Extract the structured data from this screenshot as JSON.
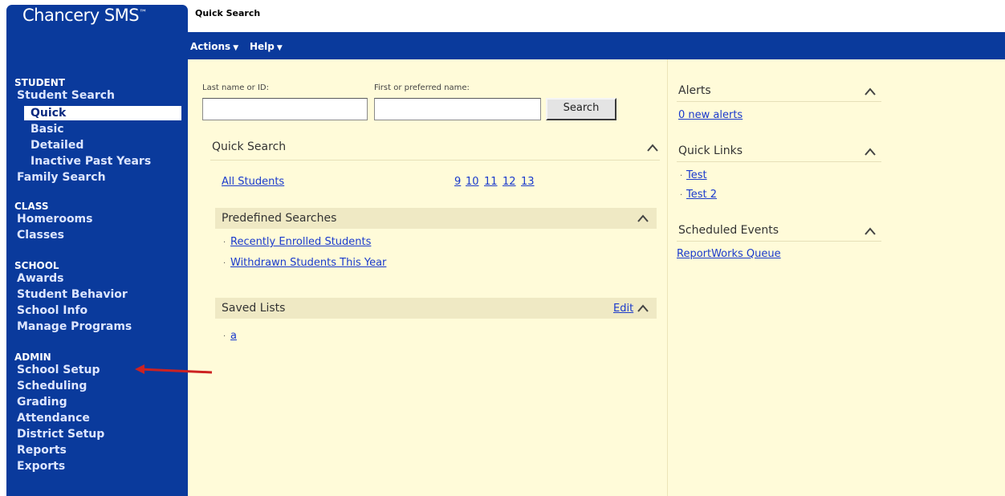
{
  "app": {
    "brand": "Chancery SMS",
    "trademark": "™",
    "page_title": "Quick Search"
  },
  "menu": [
    {
      "label": "Actions",
      "caret": "▼"
    },
    {
      "label": "Help",
      "caret": "▼"
    }
  ],
  "sidebar": {
    "student": {
      "heading": "STUDENT",
      "items": [
        {
          "label": "Student Search"
        },
        {
          "label": "Quick"
        },
        {
          "label": "Basic"
        },
        {
          "label": "Detailed"
        },
        {
          "label": "Inactive Past Years"
        },
        {
          "label": "Family Search"
        }
      ]
    },
    "class": {
      "heading": "CLASS",
      "items": [
        {
          "label": "Homerooms"
        },
        {
          "label": "Classes"
        }
      ]
    },
    "school": {
      "heading": "SCHOOL",
      "items": [
        {
          "label": "Awards"
        },
        {
          "label": "Student Behavior"
        },
        {
          "label": "School Info"
        },
        {
          "label": "Manage Programs"
        }
      ]
    },
    "admin": {
      "heading": "ADMIN",
      "items": [
        {
          "label": "School Setup"
        },
        {
          "label": "Scheduling"
        },
        {
          "label": "Grading"
        },
        {
          "label": "Attendance"
        },
        {
          "label": "District Setup"
        },
        {
          "label": "Reports"
        },
        {
          "label": "Exports"
        }
      ]
    }
  },
  "search": {
    "last_name_label": "Last name or ID:",
    "first_name_label": "First or preferred name:",
    "last_name_value": "",
    "first_name_value": "",
    "button": "Search"
  },
  "quick_search": {
    "title": "Quick Search",
    "all_students": "All Students",
    "grades": [
      "9",
      "10",
      "11",
      "12",
      "13"
    ]
  },
  "predefined": {
    "title": "Predefined Searches",
    "items": [
      "Recently Enrolled Students",
      "Withdrawn Students This Year"
    ]
  },
  "saved_lists": {
    "title": "Saved Lists",
    "edit": "Edit",
    "items": [
      "a"
    ]
  },
  "right": {
    "alerts": {
      "title": "Alerts",
      "link": "0 new alerts"
    },
    "quick_links": {
      "title": "Quick Links",
      "items": [
        "Test",
        "Test 2"
      ]
    },
    "scheduled_events": {
      "title": "Scheduled Events",
      "link": "ReportWorks Queue"
    }
  },
  "colors": {
    "nav_blue": "#0a3a9c",
    "panel": "#fffbd9",
    "link": "#1a3acc",
    "arrow": "#cc2222"
  },
  "icons": {
    "collapse": "chevron-up-icon",
    "bullet": "·"
  }
}
